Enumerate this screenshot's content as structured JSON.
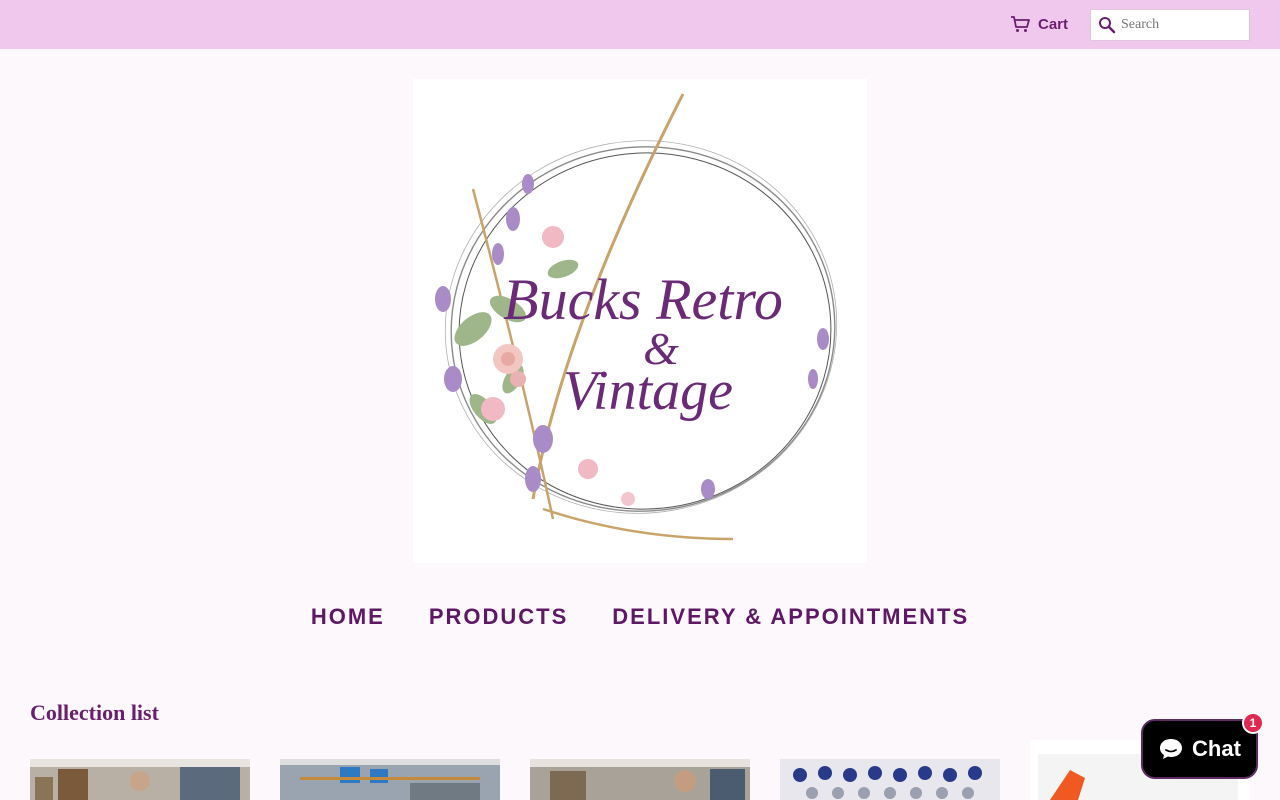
{
  "header": {
    "cart_label": "Cart",
    "cart_icon": "cart-icon",
    "search_icon": "search-icon",
    "search_placeholder": "Search",
    "search_value": ""
  },
  "logo": {
    "line1": "Bucks Retro",
    "line2": "&",
    "line3": "Vintage",
    "text_color": "#6b2a78"
  },
  "nav": {
    "items": [
      {
        "label": "HOME"
      },
      {
        "label": "PRODUCTS"
      },
      {
        "label": "DELIVERY & APPOINTMENTS"
      }
    ]
  },
  "collection": {
    "title": "Collection list"
  },
  "chat": {
    "label": "Chat",
    "badge_count": "1",
    "icon": "chat-bubble-icon"
  },
  "colors": {
    "topbar": "#f0c8ee",
    "accent": "#6a1f6e",
    "nav_text": "#5e1865",
    "page_bg": "#fcf8fc",
    "badge": "#e2284f"
  }
}
